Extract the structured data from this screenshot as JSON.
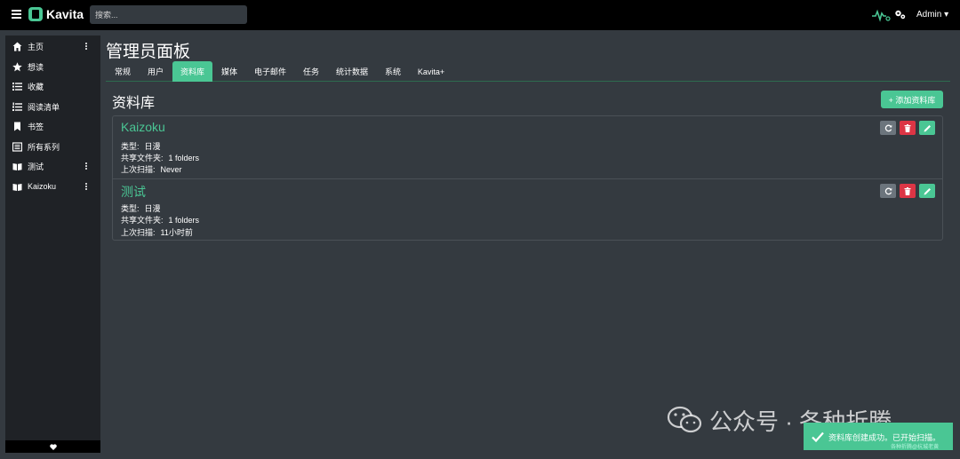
{
  "app": {
    "name": "Kavita",
    "brand_color": "#4ac694"
  },
  "search": {
    "placeholder": "搜索..."
  },
  "header": {
    "user": "Admin ▾"
  },
  "sidebar": {
    "items": [
      {
        "label": "主页",
        "icon": "home-icon",
        "more": true
      },
      {
        "label": "想读",
        "icon": "star-icon",
        "more": false
      },
      {
        "label": "收藏",
        "icon": "list-icon",
        "more": false
      },
      {
        "label": "阅读清单",
        "icon": "list-ol-icon",
        "more": false
      },
      {
        "label": "书签",
        "icon": "bookmark-icon",
        "more": false
      },
      {
        "label": "所有系列",
        "icon": "series-icon",
        "more": false
      },
      {
        "label": "测试",
        "icon": "book-open-icon",
        "more": true
      },
      {
        "label": "Kaizoku",
        "icon": "book-open-icon",
        "more": true
      }
    ],
    "footer_icon": "heart-icon"
  },
  "page": {
    "title": "管理员面板"
  },
  "tabs": [
    {
      "label": "常规"
    },
    {
      "label": "用户"
    },
    {
      "label": "资料库",
      "active": true
    },
    {
      "label": "媒体"
    },
    {
      "label": "电子邮件"
    },
    {
      "label": "任务"
    },
    {
      "label": "统计数据"
    },
    {
      "label": "系统"
    },
    {
      "label": "Kavita+"
    }
  ],
  "libraries": {
    "title": "资料库",
    "add_label": "+ 添加资料库",
    "items": [
      {
        "name": "Kaizoku",
        "type_label": "类型:",
        "type_value": "日漫",
        "folders_label": "共享文件夹:",
        "folders_value": "1 folders",
        "scan_label": "上次扫描:",
        "scan_value": "Never"
      },
      {
        "name": "测试",
        "type_label": "类型:",
        "type_value": "日漫",
        "folders_label": "共享文件夹:",
        "folders_value": "1 folders",
        "scan_label": "上次扫描:",
        "scan_value": "11小时前"
      }
    ]
  },
  "watermark": {
    "text": "公众号 · 各种折腾",
    "small": "各种折腾@杭城老黄"
  },
  "toast": {
    "message": "资料库创建成功。已开始扫描。"
  }
}
